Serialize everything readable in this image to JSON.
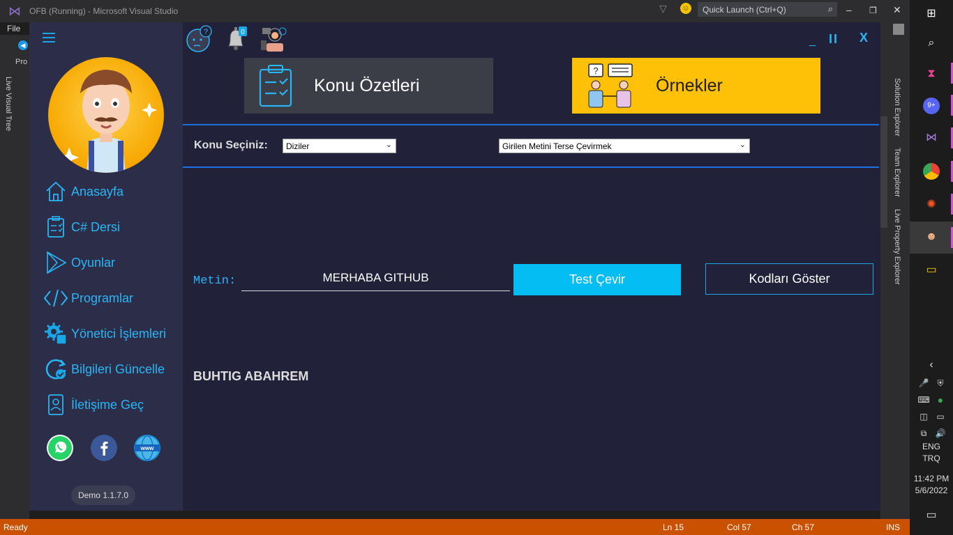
{
  "vs": {
    "title": "OFB (Running) - Microsoft Visual Studio",
    "menu_file": "File",
    "quick_launch_placeholder": "Quick Launch (Ctrl+Q)",
    "left_panel_pro": "Pro",
    "live_visual_tree": "Live Visual Tree",
    "solution_explorer": "Solution Explorer",
    "team_explorer": "Team Explorer",
    "live_property_explorer": "Live Property Explorer",
    "status": {
      "ready": "Ready",
      "ln": "Ln 15",
      "col": "Col 57",
      "ch": "Ch 57",
      "ins": "INS"
    }
  },
  "app": {
    "window_buttons": {
      "minimize": "_",
      "pause": "II",
      "close": "X"
    },
    "tabs": {
      "konu": "Konu Özetleri",
      "ornek": "Örnekler"
    },
    "topic_label": "Konu Seçiniz:",
    "topic_select": "Diziler",
    "example_select": "Girilen Metini Terse Çevirmek",
    "text_label": "Metin:",
    "text_value": "MERHABA GITHUB",
    "test_button": "Test Çevir",
    "code_button": "Kodları Göster",
    "result": "BUHTIG ABAHREM",
    "notification_count": "0"
  },
  "sidebar": {
    "items": [
      {
        "label": "Anasayfa"
      },
      {
        "label": "C# Dersi"
      },
      {
        "label": "Oyunlar"
      },
      {
        "label": "Programlar"
      },
      {
        "label": "Yönetici İşlemleri"
      },
      {
        "label": "Bilgileri Güncelle"
      },
      {
        "label": "İletişime Geç"
      }
    ],
    "version": "Demo 1.1.7.0",
    "www": "www"
  },
  "taskbar": {
    "lang1": "ENG",
    "lang2": "TRQ",
    "time": "11:42 PM",
    "date": "5/6/2022",
    "discord_badge": "9+"
  },
  "colors": {
    "accent": "#29b6f6",
    "yellow": "#ffc107",
    "status_bar": "#ca5100",
    "app_bg": "#21223a",
    "sidebar_bg": "#2c2e49"
  }
}
